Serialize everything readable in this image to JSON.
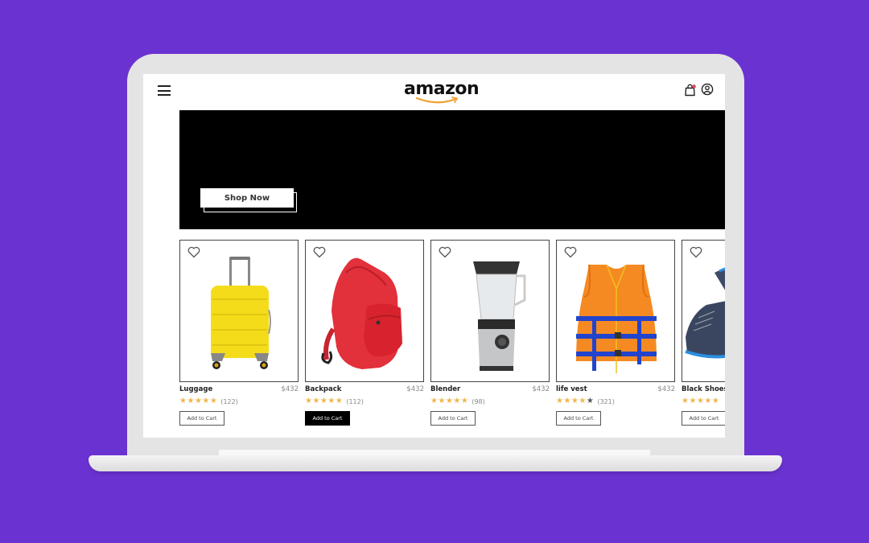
{
  "header": {
    "logo_text": "amazon",
    "menu_icon": "hamburger-menu-icon",
    "cart_icon": "shopping-bag-icon",
    "account_icon": "user-account-icon",
    "cart_badge_color": "#e0455a"
  },
  "hero": {
    "button_label": "Shop Now",
    "background_color": "#000000"
  },
  "colors": {
    "background": "#6a32d0",
    "star_filled": "#f0b54a",
    "logo_smile": "#f0a030"
  },
  "products": [
    {
      "name": "Luggage",
      "price": "$432",
      "rating": 5,
      "reviews": "(122)",
      "button": "Add to Cart",
      "button_active": false,
      "image": "yellow-suitcase"
    },
    {
      "name": "Backpack",
      "price": "$432",
      "rating": 5,
      "reviews": "(112)",
      "button": "Add to Cart",
      "button_active": true,
      "image": "red-backpack"
    },
    {
      "name": "Blender",
      "price": "$432",
      "rating": 5,
      "reviews": "(98)",
      "button": "Add to Cart",
      "button_active": false,
      "image": "blender"
    },
    {
      "name": "life vest",
      "price": "$432",
      "rating": 4,
      "reviews": "(321)",
      "button": "Add to Cart",
      "button_active": false,
      "image": "orange-life-vest"
    },
    {
      "name": "Black Shoes",
      "price": "",
      "rating": 5,
      "reviews": "",
      "button": "Add to Cart",
      "button_active": false,
      "image": "blue-suede-shoe"
    }
  ]
}
